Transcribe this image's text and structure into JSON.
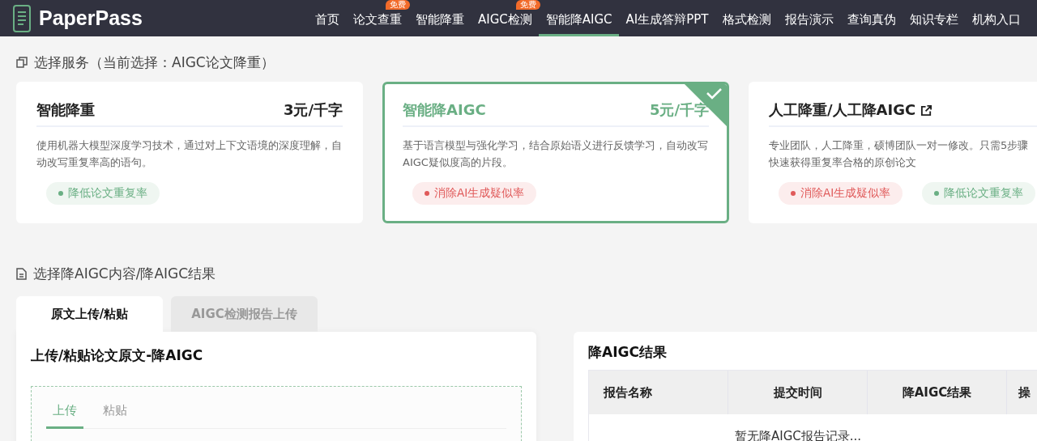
{
  "header": {
    "logo": "PaperPass",
    "nav": [
      {
        "label": "首页",
        "selected": false
      },
      {
        "label": "论文查重",
        "selected": false,
        "badge": "免费"
      },
      {
        "label": "智能降重",
        "selected": false
      },
      {
        "label": "AIGC检测",
        "selected": false,
        "badge": "免费"
      },
      {
        "label": "智能降AIGC",
        "selected": true
      },
      {
        "label": "AI生成答辩PPT",
        "selected": false
      },
      {
        "label": "格式检测",
        "selected": false
      },
      {
        "label": "报告演示",
        "selected": false
      },
      {
        "label": "查询真伪",
        "selected": false
      },
      {
        "label": "知识专栏",
        "selected": false
      },
      {
        "label": "机构入口",
        "selected": false
      }
    ]
  },
  "services": {
    "heading": "选择服务（当前选择：AIGC论文降重）",
    "cards": [
      {
        "title": "智能降重",
        "price": "3元/千字",
        "selected": false,
        "external": false,
        "description": "使用机器大模型深度学习技术，通过对上下文语境的深度理解，自动改写重复率高的语句。",
        "tags": [
          {
            "label": "降低论文重复率",
            "color": "#6aaf84"
          }
        ]
      },
      {
        "title": "智能降AIGC",
        "price": "5元/千字",
        "selected": true,
        "external": false,
        "description": "基于语言模型与强化学习，结合原始语义进行反馈学习，自动改写AIGC疑似度高的片段。",
        "tags": [
          {
            "label": "消除AI生成疑似率",
            "color": "#e05a5a"
          }
        ]
      },
      {
        "title": "人工降重/人工降AIGC",
        "selected": false,
        "external": true,
        "description": "专业团队，人工降重，硕博团队一对一修改。只需5步骤快速获得重复率合格的原创论文",
        "tags": [
          {
            "label": "消除AI生成疑似率",
            "color": "#e05a5a"
          },
          {
            "label": "降低论文重复率",
            "color": "#6aaf84"
          }
        ]
      }
    ]
  },
  "content": {
    "heading": "选择降AIGC内容/降AIGC结果",
    "tabs": [
      {
        "label": "原文上传/粘贴",
        "selected": true
      },
      {
        "label": "AIGC检测报告上传",
        "selected": false
      }
    ],
    "panel_title": "上传/粘贴论文原文-降AIGC",
    "subtabs": [
      {
        "label": "上传",
        "selected": true
      },
      {
        "label": "粘贴",
        "selected": false
      }
    ]
  },
  "results": {
    "title": "降AIGC结果",
    "columns": [
      "报告名称",
      "提交时间",
      "降AIGC结果",
      "操"
    ],
    "empty": "暂无降AIGC报告记录..."
  }
}
